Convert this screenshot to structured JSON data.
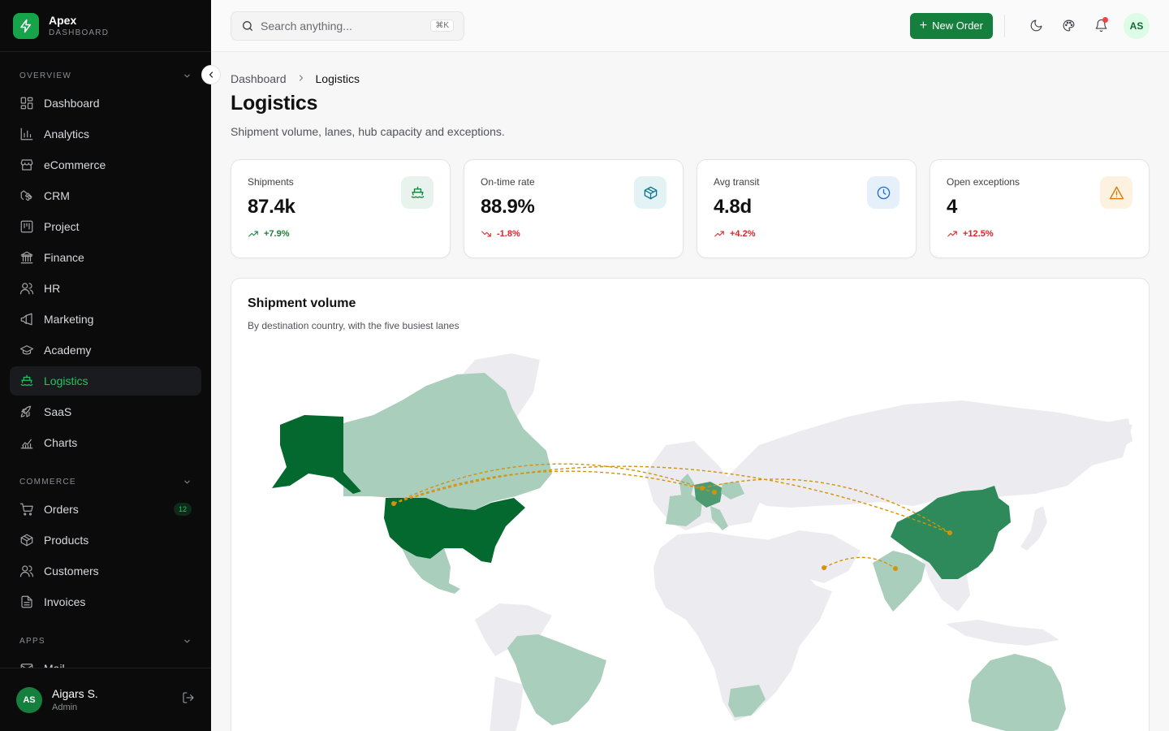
{
  "brand": {
    "name": "Apex",
    "sub": "DASHBOARD"
  },
  "sidebar": {
    "sections": [
      {
        "title": "OVERVIEW",
        "items": [
          {
            "label": "Dashboard",
            "icon": "grid-icon"
          },
          {
            "label": "Analytics",
            "icon": "bar-chart-icon"
          },
          {
            "label": "eCommerce",
            "icon": "store-icon"
          },
          {
            "label": "CRM",
            "icon": "handshake-icon"
          },
          {
            "label": "Project",
            "icon": "kanban-icon"
          },
          {
            "label": "Finance",
            "icon": "bank-icon"
          },
          {
            "label": "HR",
            "icon": "users-icon"
          },
          {
            "label": "Marketing",
            "icon": "megaphone-icon"
          },
          {
            "label": "Academy",
            "icon": "graduation-cap-icon"
          },
          {
            "label": "Logistics",
            "icon": "ship-icon",
            "active": true
          },
          {
            "label": "SaaS",
            "icon": "rocket-icon"
          },
          {
            "label": "Charts",
            "icon": "chart-line-icon"
          }
        ]
      },
      {
        "title": "COMMERCE",
        "items": [
          {
            "label": "Orders",
            "icon": "cart-icon",
            "badge": "12"
          },
          {
            "label": "Products",
            "icon": "package-icon"
          },
          {
            "label": "Customers",
            "icon": "users-icon"
          },
          {
            "label": "Invoices",
            "icon": "file-icon"
          }
        ]
      },
      {
        "title": "APPS",
        "items": [
          {
            "label": "Mail",
            "icon": "mail-icon"
          }
        ]
      }
    ]
  },
  "user": {
    "initials": "AS",
    "name": "Aigars S.",
    "role": "Admin"
  },
  "search": {
    "placeholder": "Search anything...",
    "shortcut": "⌘K"
  },
  "header": {
    "new_order_label": "New Order",
    "avatar_initials": "AS"
  },
  "breadcrumb": {
    "parent": "Dashboard",
    "current": "Logistics"
  },
  "page": {
    "title": "Logistics",
    "subtitle": "Shipment volume, lanes, hub capacity and exceptions."
  },
  "kpis": [
    {
      "label": "Shipments",
      "value": "87.4k",
      "delta": "+7.9%",
      "trend": "up",
      "tone": "green",
      "icon": "ship-icon",
      "icon_bg": "#e7f3ec",
      "icon_color": "#15803d"
    },
    {
      "label": "On-time rate",
      "value": "88.9%",
      "delta": "-1.8%",
      "trend": "down",
      "tone": "red",
      "icon": "package-icon",
      "icon_bg": "#e3f3f5",
      "icon_color": "#0e7490"
    },
    {
      "label": "Avg transit",
      "value": "4.8d",
      "delta": "+4.2%",
      "trend": "up",
      "tone": "red",
      "icon": "clock-icon",
      "icon_bg": "#e6f0fb",
      "icon_color": "#1d6fd1"
    },
    {
      "label": "Open exceptions",
      "value": "4",
      "delta": "+12.5%",
      "trend": "up",
      "tone": "red",
      "icon": "warning-icon",
      "icon_bg": "#fdf1e0",
      "icon_color": "#d97706"
    }
  ],
  "map": {
    "title": "Shipment volume",
    "subtitle": "By destination country, with the five busiest lanes",
    "colors": {
      "base": "#ececf0",
      "light": "#a9cebb",
      "medium": "#4e9b72",
      "strong": "#2e8a5a",
      "darkest": "#04692f",
      "lane": "#d4920a"
    }
  }
}
